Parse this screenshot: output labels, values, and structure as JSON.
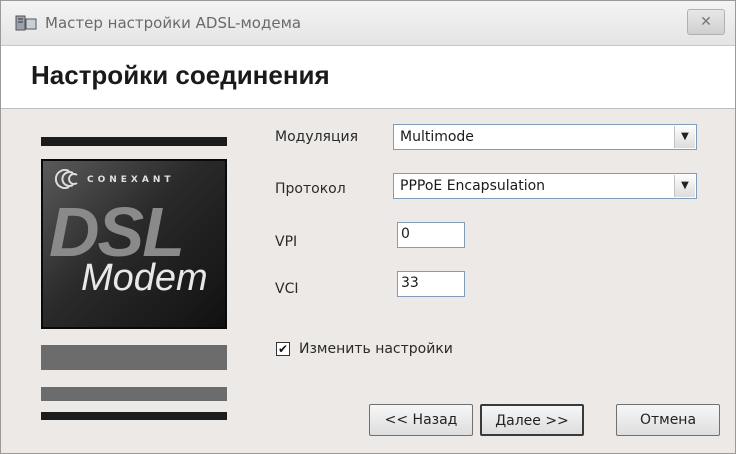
{
  "window": {
    "title": "Мастер настройки ADSL-модема",
    "close_label": "✕"
  },
  "header": {
    "title": "Настройки соединения"
  },
  "logo": {
    "brand": "CONEXANT",
    "dsl": "DSL",
    "modem": "Modem"
  },
  "form": {
    "modulation": {
      "label": "Модуляция",
      "value": "Multimode"
    },
    "protocol": {
      "label": "Протокол",
      "value": "PPPoE Encapsulation"
    },
    "vpi": {
      "label": "VPI",
      "value": "0"
    },
    "vci": {
      "label": "VCI",
      "value": "33"
    },
    "change_settings": {
      "label": "Изменить настройки",
      "checked": true,
      "mark": "✔"
    }
  },
  "buttons": {
    "back": "<< Назад",
    "next": "Далее >>",
    "cancel": "Отмена"
  }
}
